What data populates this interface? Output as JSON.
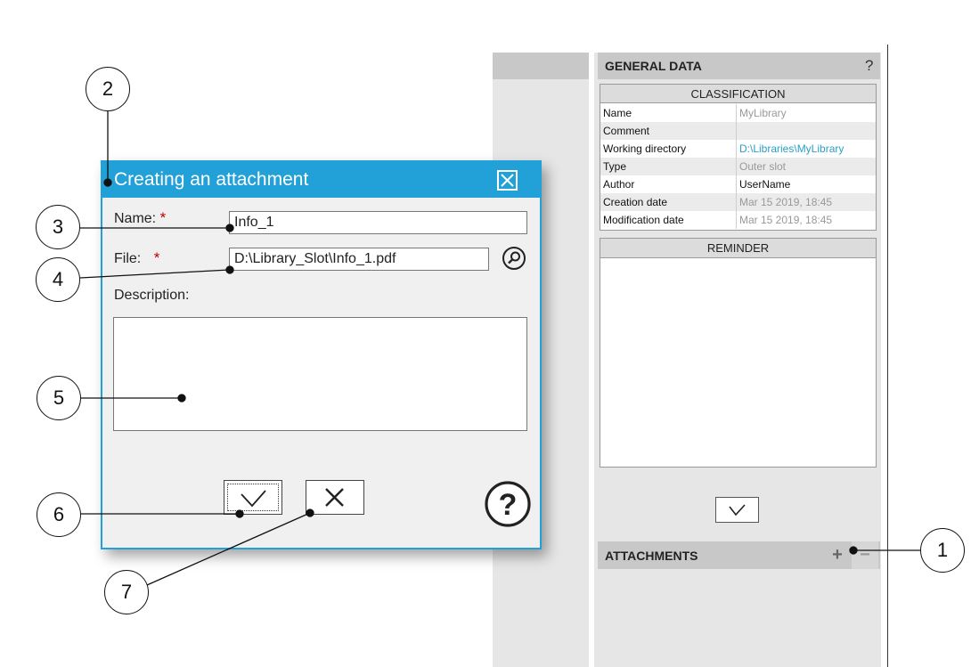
{
  "panel": {
    "general_title": "GENERAL DATA",
    "help_label": "?",
    "classification_title": "CLASSIFICATION",
    "rows": [
      {
        "key": "Name",
        "value": "MyLibrary"
      },
      {
        "key": "Comment",
        "value": ""
      },
      {
        "key": "Working directory",
        "value": "D:\\Libraries\\MyLibrary"
      },
      {
        "key": "Type",
        "value": "Outer slot"
      },
      {
        "key": "Author",
        "value": "UserName"
      },
      {
        "key": "Creation date",
        "value": "Mar 15 2019, 18:45"
      },
      {
        "key": "Modification date",
        "value": "Mar 15 2019, 18:45"
      }
    ],
    "reminder_title": "REMINDER",
    "attachments_title": "ATTACHMENTS",
    "add_label": "+",
    "remove_label": "−"
  },
  "dialog": {
    "title": "Creating an attachment",
    "name_label": "Name:",
    "required_mark": "*",
    "name_value": "Info_1",
    "file_label": "File:",
    "file_value": "D:\\Library_Slot\\Info_1.pdf",
    "description_label": "Description:",
    "description_value": ""
  },
  "callouts": [
    "1",
    "2",
    "3",
    "4",
    "5",
    "6",
    "7"
  ],
  "colors": {
    "accent": "#21a1d8",
    "link": "#2aa0c8",
    "required": "#bb0000"
  }
}
